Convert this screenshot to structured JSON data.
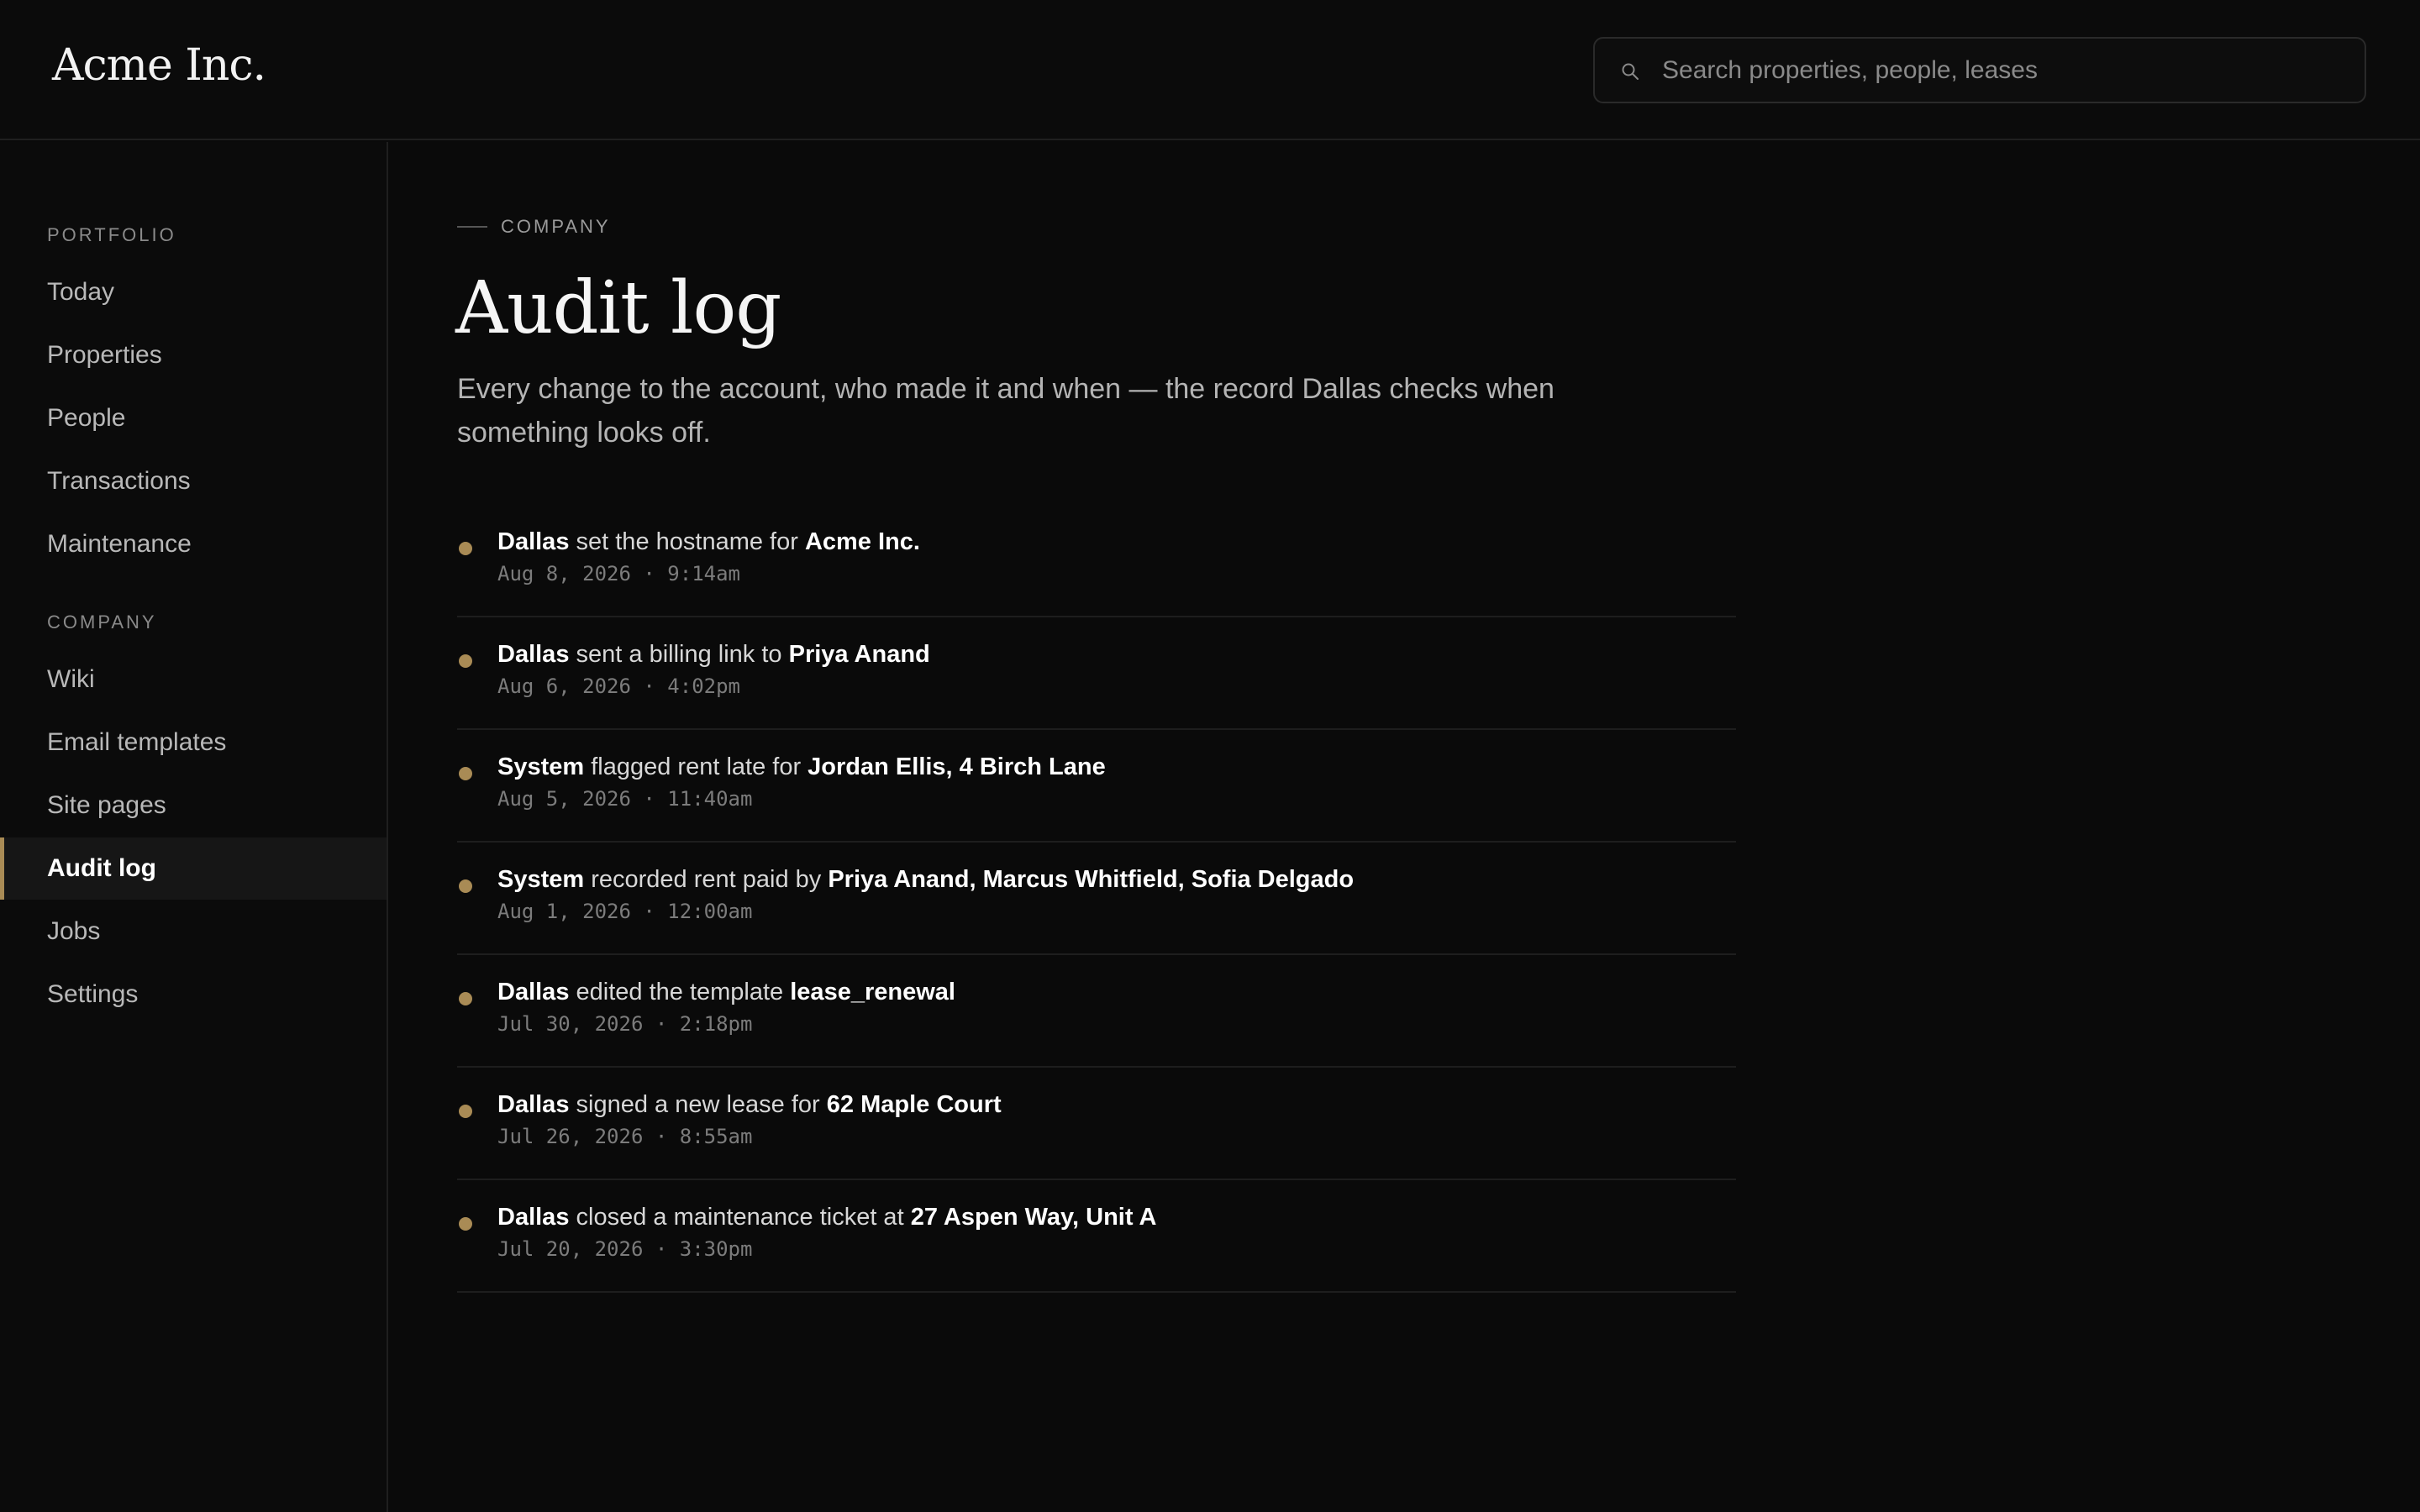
{
  "app": {
    "brand": "Acme Inc."
  },
  "search": {
    "placeholder": "Search properties, people, leases",
    "icon": "search-icon"
  },
  "sidebar": {
    "sections": [
      {
        "label": "PORTFOLIO",
        "items": [
          {
            "label": "Today"
          },
          {
            "label": "Properties"
          },
          {
            "label": "People"
          },
          {
            "label": "Transactions"
          },
          {
            "label": "Maintenance"
          }
        ]
      },
      {
        "label": "COMPANY",
        "items": [
          {
            "label": "Wiki"
          },
          {
            "label": "Email templates"
          },
          {
            "label": "Site pages"
          },
          {
            "label": "Audit log",
            "active": true
          },
          {
            "label": "Jobs"
          },
          {
            "label": "Settings"
          }
        ]
      }
    ]
  },
  "page": {
    "eyebrow": "COMPANY",
    "title": "Audit log",
    "description": "Every change to the account, who made it and when — the record Dallas checks when something looks off."
  },
  "audit": [
    {
      "actor": "Dallas",
      "action": " set the hostname for ",
      "target": "Acme Inc.",
      "time": "Aug 8, 2026 · 9:14am"
    },
    {
      "actor": "Dallas",
      "action": " sent a billing link to ",
      "target": "Priya Anand",
      "time": "Aug 6, 2026 · 4:02pm"
    },
    {
      "actor": "System",
      "action": " flagged rent late for ",
      "target": "Jordan Ellis, 4 Birch Lane",
      "time": "Aug 5, 2026 · 11:40am"
    },
    {
      "actor": "System",
      "action": " recorded rent paid by ",
      "target": "Priya Anand, Marcus Whitfield, Sofia Delgado",
      "time": "Aug 1, 2026 · 12:00am"
    },
    {
      "actor": "Dallas",
      "action": " edited the template ",
      "target": "lease_renewal",
      "time": "Jul 30, 2026 · 2:18pm"
    },
    {
      "actor": "Dallas",
      "action": " signed a new lease for ",
      "target": "62 Maple Court",
      "time": "Jul 26, 2026 · 8:55am"
    },
    {
      "actor": "Dallas",
      "action": " closed a maintenance ticket at ",
      "target": "27 Aspen Way, Unit A",
      "time": "Jul 20, 2026 · 3:30pm"
    }
  ],
  "colors": {
    "accent": "#a98b55",
    "background": "#0a0a0a"
  }
}
